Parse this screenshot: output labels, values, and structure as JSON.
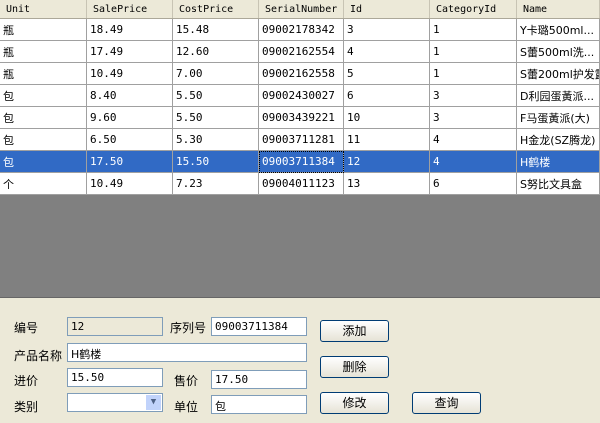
{
  "grid": {
    "columns": [
      "Unit",
      "SalePrice",
      "CostPrice",
      "SerialNumber",
      "Id",
      "CategoryId",
      "Name"
    ],
    "rows": [
      [
        "瓶",
        "18.49",
        "15.48",
        "09002178342",
        "3",
        "1",
        "Y卡璐500ml..."
      ],
      [
        "瓶",
        "17.49",
        "12.60",
        "09002162554",
        "4",
        "1",
        "S蕾500ml洗..."
      ],
      [
        "瓶",
        "10.49",
        "7.00",
        "09002162558",
        "5",
        "1",
        "S蕾200ml护发露"
      ],
      [
        "包",
        "8.40",
        "5.50",
        "09002430027",
        "6",
        "3",
        "D利园蛋黃派..."
      ],
      [
        "包",
        "9.60",
        "5.50",
        "09003439221",
        "10",
        "3",
        "F马蛋黃派(大)"
      ],
      [
        "包",
        "6.50",
        "5.30",
        "09003711281",
        "11",
        "4",
        "H金龙(SZ腾龙)"
      ],
      [
        "包",
        "17.50",
        "15.50",
        "09003711384",
        "12",
        "4",
        "H鹤楼"
      ],
      [
        "个",
        "10.49",
        "7.23",
        "09004011123",
        "13",
        "6",
        "S努比文具盒"
      ]
    ],
    "selected_row": 6
  },
  "form": {
    "id_label": "编号",
    "id_value": "12",
    "serial_label": "序列号",
    "serial_value": "09003711384",
    "name_label": "产品名称",
    "name_value": "H鹤楼",
    "cost_label": "进价",
    "cost_value": "15.50",
    "sale_label": "售价",
    "sale_value": "17.50",
    "category_label": "类别",
    "category_value": "",
    "unit_label": "单位",
    "unit_value": "包"
  },
  "buttons": {
    "add": "添加",
    "delete": "删除",
    "modify": "修改",
    "query": "查询"
  }
}
